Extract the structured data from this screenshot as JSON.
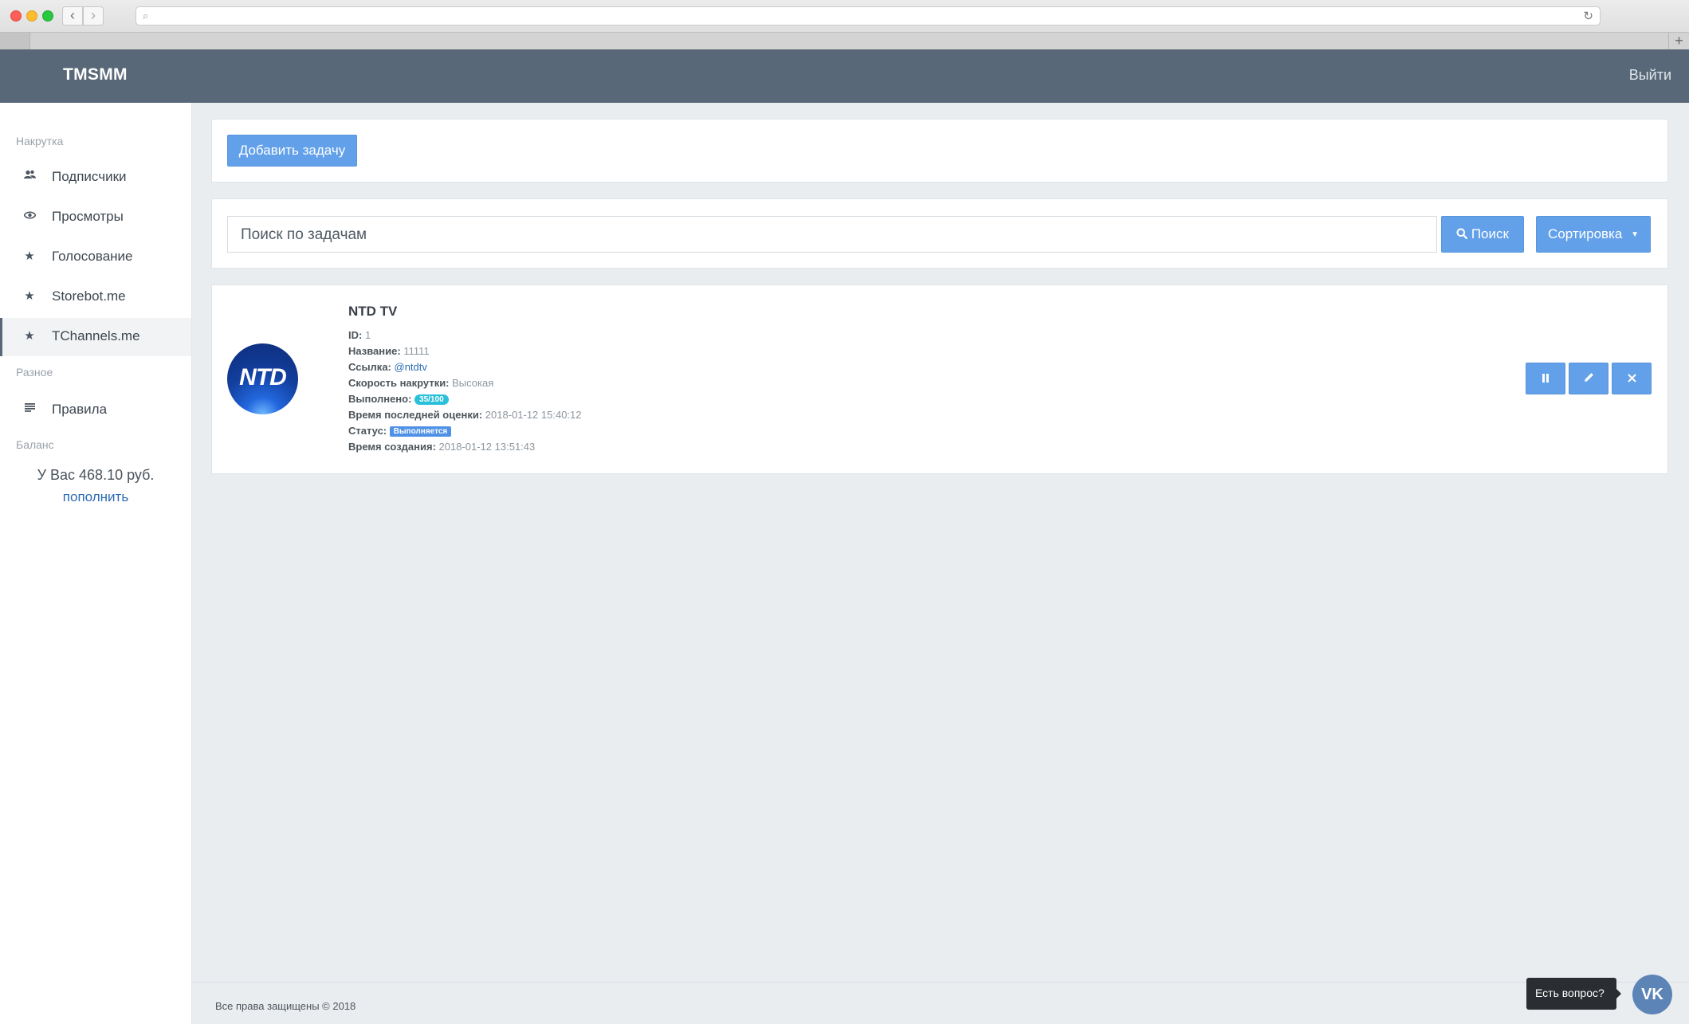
{
  "app": {
    "brand": "TMSMM",
    "logout_label": "Выйти"
  },
  "sidebar": {
    "section_boost": "Накрутка",
    "items": [
      {
        "label": "Подписчики",
        "icon": "users-icon"
      },
      {
        "label": "Просмотры",
        "icon": "eye-icon"
      },
      {
        "label": "Голосование",
        "icon": "star-icon"
      },
      {
        "label": "Storebot.me",
        "icon": "star-icon"
      },
      {
        "label": "TChannels.me",
        "icon": "star-icon",
        "active": true
      }
    ],
    "section_misc": "Разное",
    "rules_label": "Правила",
    "section_balance": "Баланс",
    "balance_text": "У Вас 468.10 руб.",
    "topup_label": "пополнить"
  },
  "toolbar": {
    "add_task_label": "Добавить задачу"
  },
  "search": {
    "placeholder": "Поиск по задачам",
    "search_label": "Поиск",
    "sort_label": "Сортировка"
  },
  "task": {
    "title": "NTD TV",
    "avatar_text": "NTD",
    "id_label": "ID:",
    "id_value": "1",
    "name_label": "Название:",
    "name_value": "11111",
    "link_label": "Ссылка:",
    "link_value": "@ntdtv",
    "speed_label": "Скорость накрутки:",
    "speed_value": "Высокая",
    "done_label": "Выполнено:",
    "done_value": "35/100",
    "last_eval_label": "Время последней оценки:",
    "last_eval_value": "2018-01-12 15:40:12",
    "status_label": "Статус:",
    "status_value": "Выполняется",
    "created_label": "Время создания:",
    "created_value": "2018-01-12 13:51:43"
  },
  "footer": {
    "copyright": "Все права защищены © 2018",
    "question_label": "Есть вопрос?",
    "vk_label": "VK"
  }
}
